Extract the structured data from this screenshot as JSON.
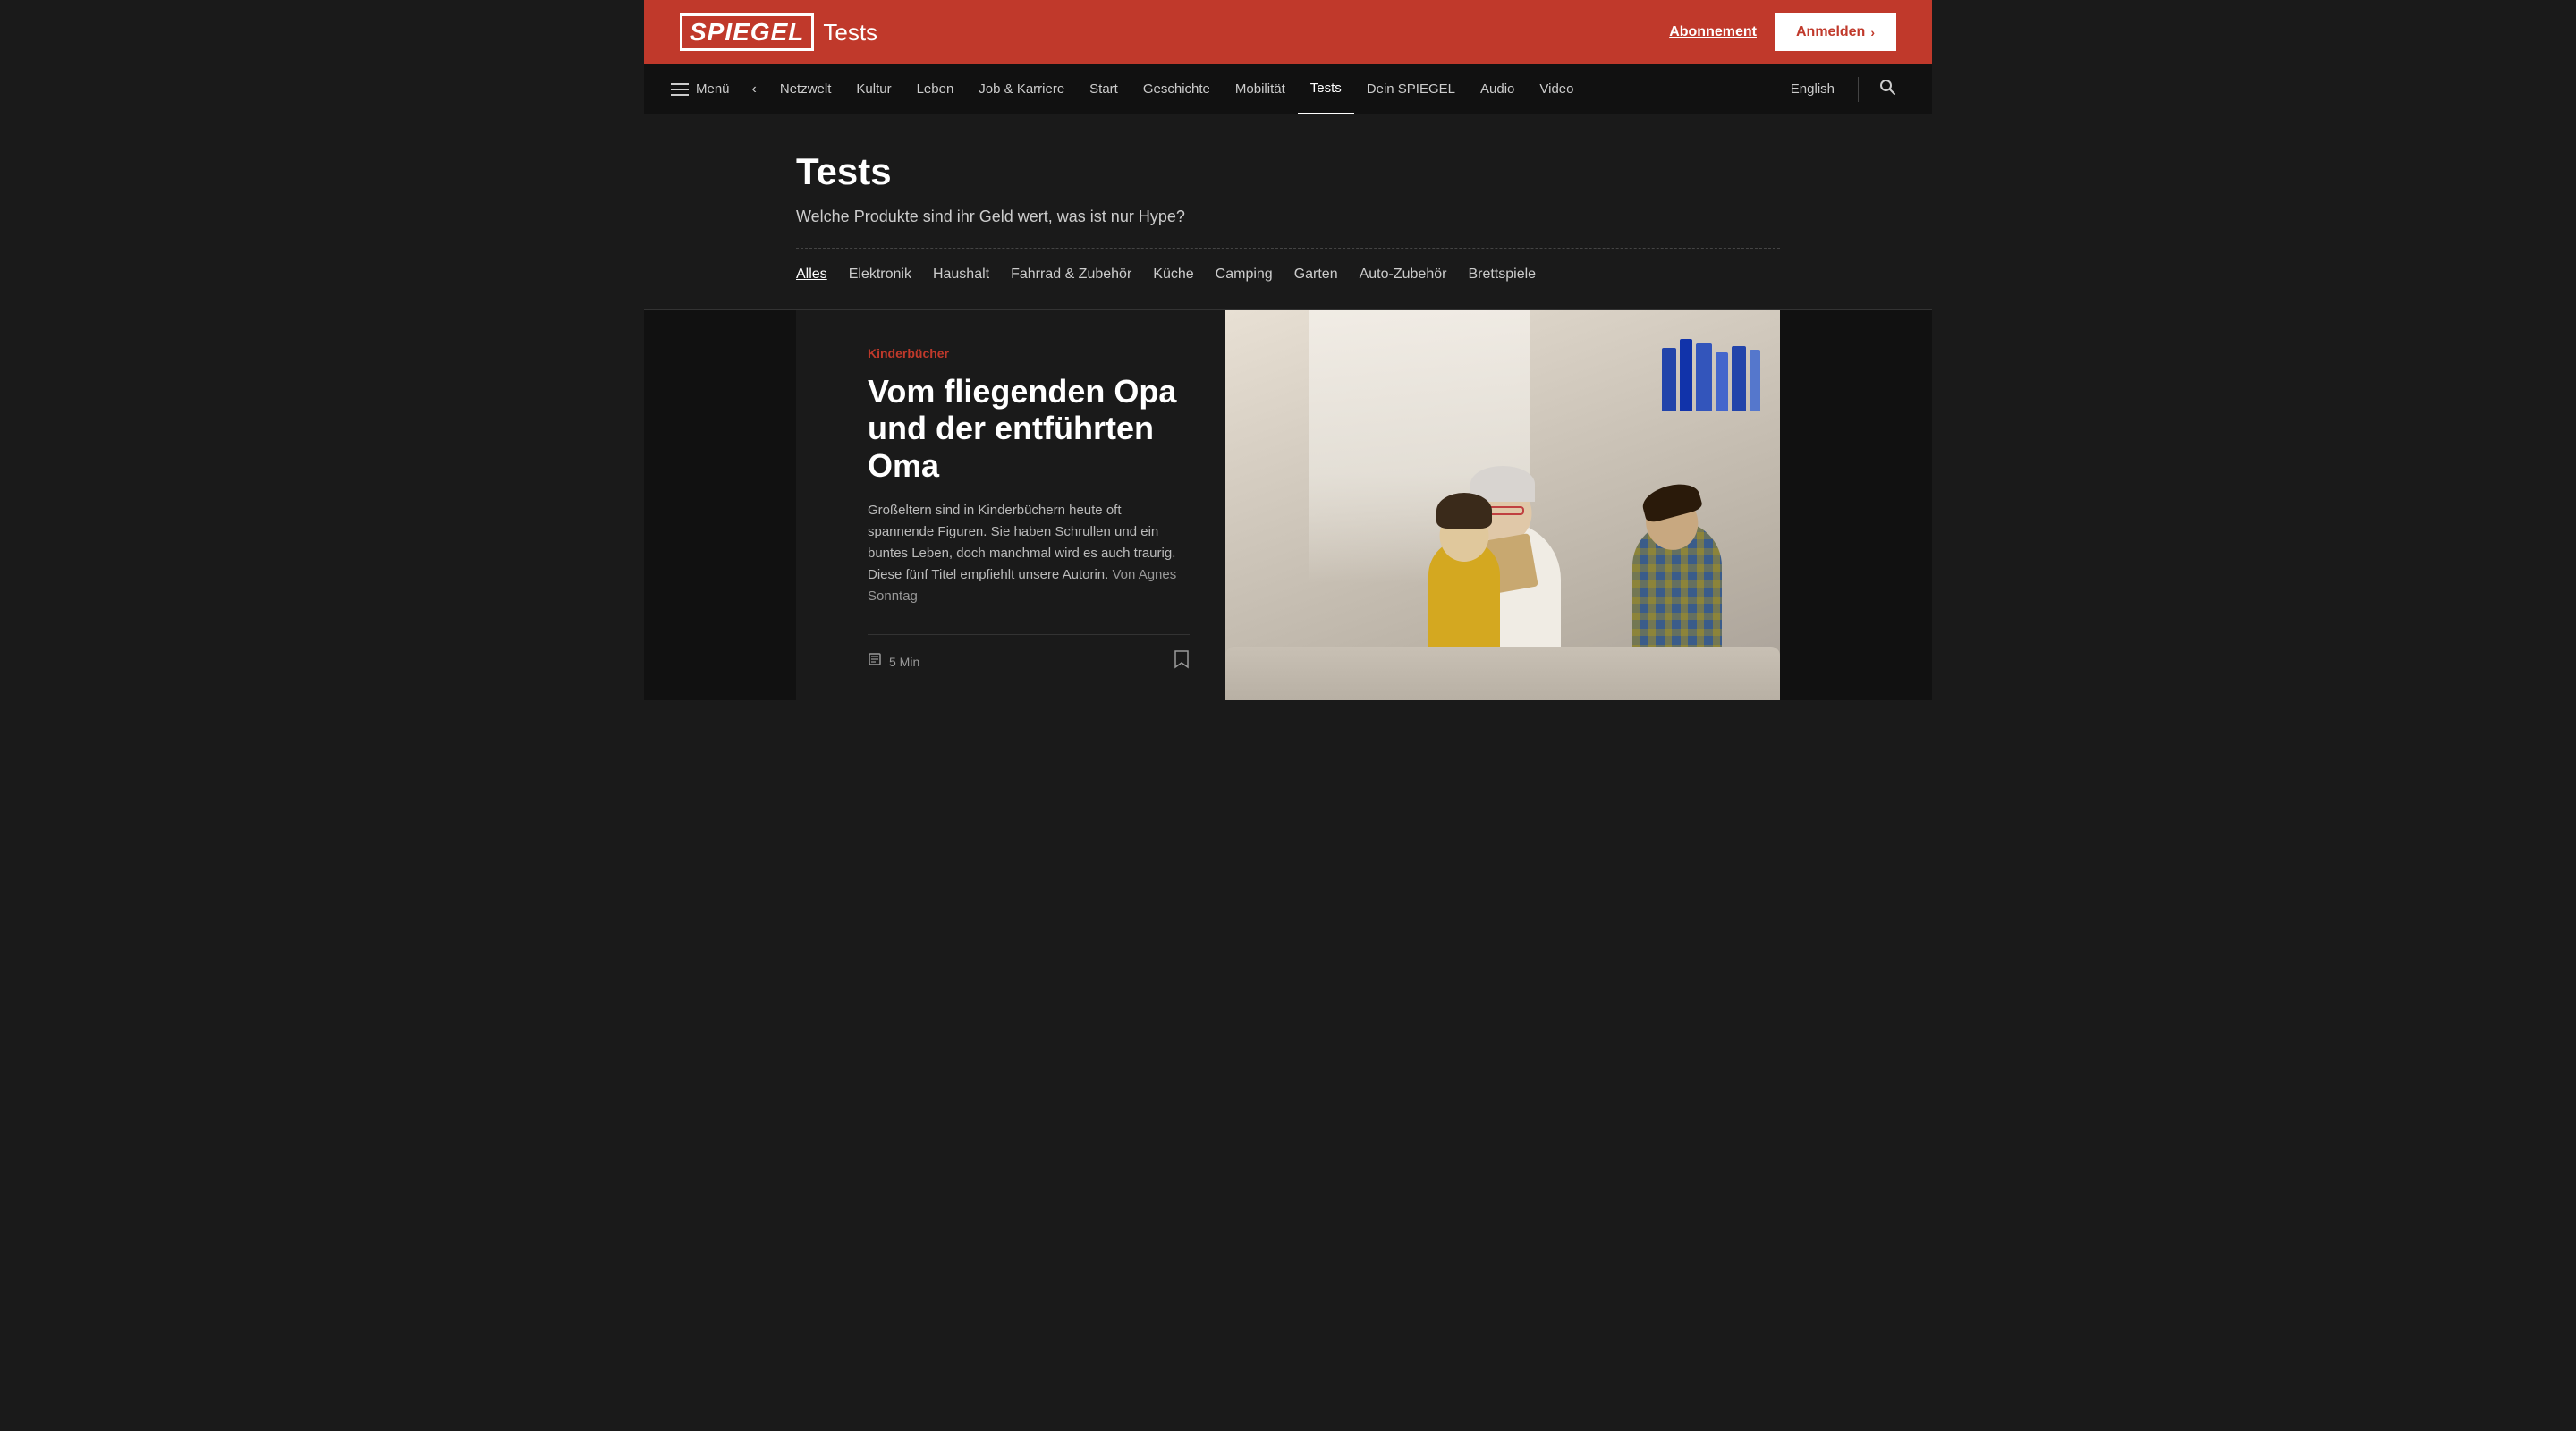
{
  "brand": {
    "logo_spiegel": "SPIEGEL",
    "logo_section": "Tests"
  },
  "topbar": {
    "abonnement_label": "Abonnement",
    "anmelden_label": "Anmelden",
    "anmelden_arrow": "›"
  },
  "navbar": {
    "menu_label": "Menü",
    "back_icon": "‹",
    "items": [
      {
        "label": "Netzwelt",
        "active": false
      },
      {
        "label": "Kultur",
        "active": false
      },
      {
        "label": "Leben",
        "active": false
      },
      {
        "label": "Job & Karriere",
        "active": false
      },
      {
        "label": "Start",
        "active": false
      },
      {
        "label": "Geschichte",
        "active": false
      },
      {
        "label": "Mobilität",
        "active": false
      },
      {
        "label": "Tests",
        "active": true
      },
      {
        "label": "Dein SPIEGEL",
        "active": false
      },
      {
        "label": "Audio",
        "active": false
      },
      {
        "label": "Video",
        "active": false
      }
    ],
    "english_label": "English",
    "search_icon": "🔍"
  },
  "page_header": {
    "title": "Tests",
    "subtitle": "Welche Produkte sind ihr Geld wert, was ist nur Hype?",
    "filters": [
      {
        "label": "Alles",
        "active": true
      },
      {
        "label": "Elektronik",
        "active": false
      },
      {
        "label": "Haushalt",
        "active": false
      },
      {
        "label": "Fahrrad & Zubehör",
        "active": false
      },
      {
        "label": "Küche",
        "active": false
      },
      {
        "label": "Camping",
        "active": false
      },
      {
        "label": "Garten",
        "active": false
      },
      {
        "label": "Auto-Zubehör",
        "active": false
      },
      {
        "label": "Brettspiele",
        "active": false
      }
    ]
  },
  "article": {
    "category": "Kinderbücher",
    "title": "Vom fliegenden Opa und der entführten Oma",
    "excerpt": "Großeltern sind in Kinderbüchern heute oft spannende Figuren. Sie haben Schrullen und ein buntes Leben, doch manchmal wird es auch traurig. Diese fünf Titel empfiehlt unsere Autorin.",
    "author_prefix": "Von",
    "author_name": "Agnes Sonntag",
    "reading_time": "5 Min",
    "time_icon": "📄"
  },
  "icons": {
    "hamburger": "☰",
    "back": "‹",
    "search": "⌕",
    "bookmark": "⊓",
    "clock": "▤"
  }
}
